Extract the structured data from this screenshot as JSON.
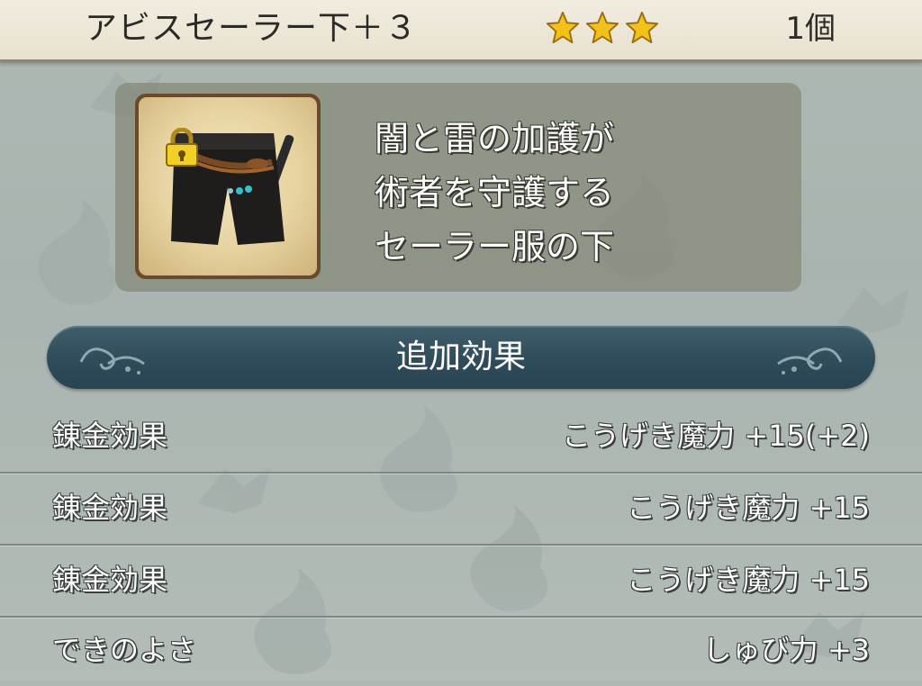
{
  "header": {
    "item_name": "アビスセーラー下＋３",
    "star_rating": 3,
    "star_icon": "star-icon",
    "star_color": "#f2c21a",
    "quantity": "1個"
  },
  "item": {
    "icon": "black-pants-icon",
    "locked": true,
    "lock_icon": "padlock-icon",
    "description": [
      "闇と雷の加護が",
      "術者を守護する",
      "セーラー服の下"
    ]
  },
  "section": {
    "title": "追加効果",
    "color": "#2f4c5a"
  },
  "effects": [
    {
      "label": "錬金効果",
      "value": "こうげき魔力 +15(+2)"
    },
    {
      "label": "錬金効果",
      "value": "こうげき魔力 +15"
    },
    {
      "label": "錬金効果",
      "value": "こうげき魔力 +15"
    },
    {
      "label": "できのよさ",
      "value": "しゅび力 +3"
    }
  ]
}
